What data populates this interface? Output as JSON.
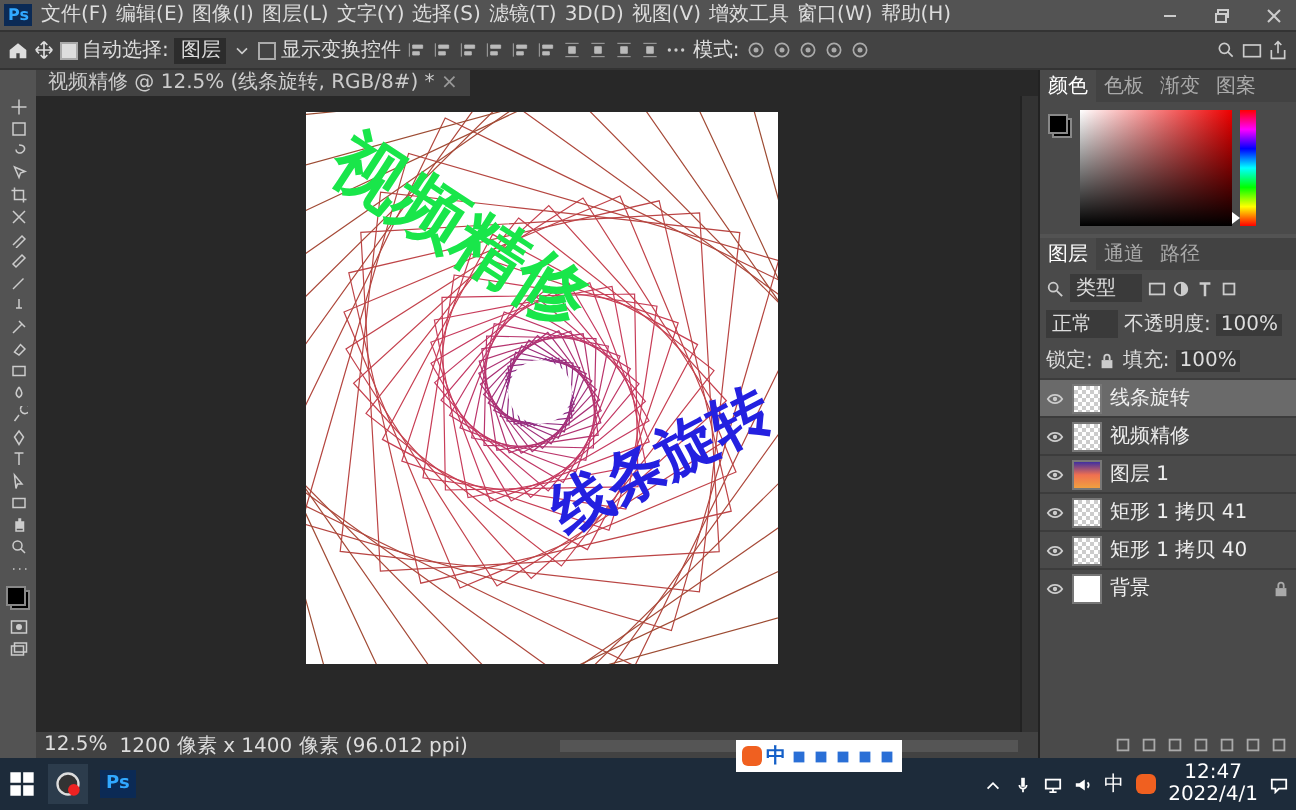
{
  "app": {
    "logo": "Ps"
  },
  "menu": [
    "文件(F)",
    "编辑(E)",
    "图像(I)",
    "图层(L)",
    "文字(Y)",
    "选择(S)",
    "滤镜(T)",
    "3D(D)",
    "视图(V)",
    "增效工具",
    "窗口(W)",
    "帮助(H)"
  ],
  "options_bar": {
    "auto_select_label": "自动选择:",
    "auto_select_checked": true,
    "target": "图层",
    "show_transform_label": "显示变换控件",
    "show_transform_checked": false,
    "mode_label": "模式:"
  },
  "document_tab": {
    "title": "视频精修 @ 12.5% (线条旋转, RGB/8#) *",
    "close": "×"
  },
  "artwork": {
    "top_text": "视频精修",
    "bottom_text": "线条旋转"
  },
  "color_panel": {
    "hue_slider": {
      "level": 0.02
    },
    "tabs": [
      {
        "label": "颜色",
        "selected": true
      },
      {
        "label": "色板",
        "selected": false
      },
      {
        "label": "渐变",
        "selected": false
      },
      {
        "label": "图案",
        "selected": false
      }
    ]
  },
  "layers_panel": {
    "tabs": [
      {
        "label": "图层",
        "selected": true
      },
      {
        "label": "通道",
        "selected": false
      },
      {
        "label": "路径",
        "selected": false
      }
    ],
    "filter": "类型",
    "blend_mode": "正常",
    "opacity_label": "不透明度:",
    "opacity": "100%",
    "lock_label": "锁定:",
    "fill_label": "填充:",
    "fill": "100%",
    "layers": [
      {
        "name": "线条旋转",
        "kind": "checker",
        "selected": true,
        "locked": false
      },
      {
        "name": "视频精修",
        "kind": "checker",
        "selected": false,
        "locked": false
      },
      {
        "name": "图层 1",
        "kind": "gradient",
        "selected": false,
        "locked": false
      },
      {
        "name": "矩形 1 拷贝 41",
        "kind": "checker",
        "selected": false,
        "locked": false
      },
      {
        "name": "矩形 1 拷贝 40",
        "kind": "checker",
        "selected": false,
        "locked": false
      },
      {
        "name": "背景",
        "kind": "white",
        "selected": false,
        "locked": true
      }
    ]
  },
  "status_bar": {
    "zoom": "12.5%",
    "info": "1200 像素 x 1400 像素 (96.012 ppi)"
  },
  "ime_toolbar": {
    "mode": "中"
  },
  "taskbar": {
    "ps_label": "Ps",
    "ime": "中",
    "time": "12:47",
    "date": "2022/4/1"
  }
}
